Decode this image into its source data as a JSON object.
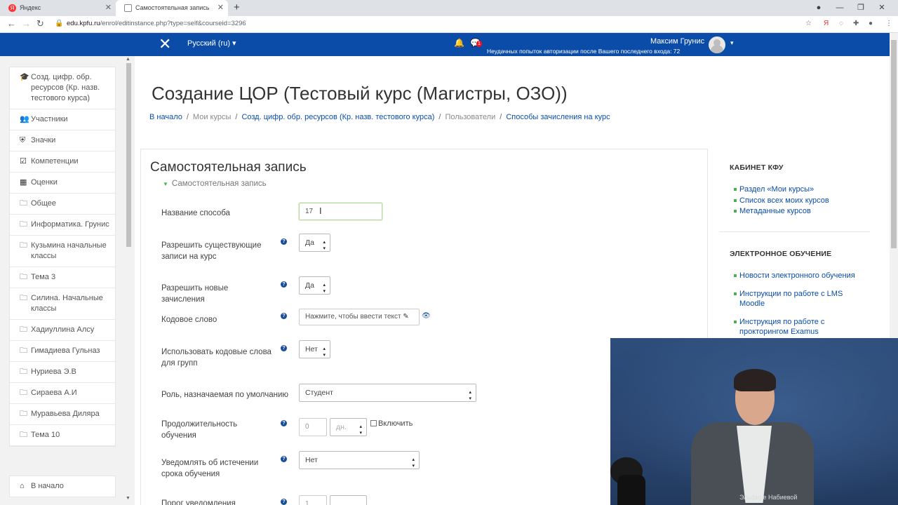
{
  "browser": {
    "tabs": [
      {
        "label": "Яндекс",
        "icon": "yandex-icon"
      },
      {
        "label": "Самостоятельная запись",
        "icon": "moodle-icon"
      }
    ],
    "url_host": "edu.kpfu.ru",
    "url_path": "/enrol/editinstance.php?type=self&courseid=3296"
  },
  "navbar": {
    "language": "Русский (ru)",
    "username": "Максим Грунис",
    "failed_logins": "Неудачных попыток авторизации после Вашего последнего входа: 72",
    "message_badge": "1"
  },
  "drawer": {
    "items": [
      {
        "label": "Созд. цифр. обр. ресурсов (Кр. назв. тестового курса)",
        "icon": "graduation-cap-icon"
      },
      {
        "label": "Участники",
        "icon": "users-icon"
      },
      {
        "label": "Значки",
        "icon": "shield-icon"
      },
      {
        "label": "Компетенции",
        "icon": "checkbox-icon"
      },
      {
        "label": "Оценки",
        "icon": "table-icon"
      },
      {
        "label": "Общее",
        "icon": "folder-icon"
      },
      {
        "label": "Информатика. Грунис",
        "icon": "folder-icon"
      },
      {
        "label": "Кузьмина начальные классы",
        "icon": "folder-icon"
      },
      {
        "label": "Тема 3",
        "icon": "folder-icon"
      },
      {
        "label": "Силина. Начальные классы",
        "icon": "folder-icon"
      },
      {
        "label": "Хадиуллина Алсу",
        "icon": "folder-icon"
      },
      {
        "label": "Гимадиева Гульназ",
        "icon": "folder-icon"
      },
      {
        "label": "Нуриева Э.В",
        "icon": "folder-icon"
      },
      {
        "label": "Сираева А.И",
        "icon": "folder-icon"
      },
      {
        "label": "Муравьева Диляра",
        "icon": "folder-icon"
      },
      {
        "label": "Тема 10",
        "icon": "folder-icon"
      }
    ],
    "home": "В начало"
  },
  "page": {
    "title": "Создание ЦОР (Тестовый курс (Магистры, ОЗО))",
    "breadcrumb": [
      "В начало",
      "Мои курсы",
      "Созд. цифр. обр. ресурсов (Кр. назв. тестового курса)",
      "Пользователи",
      "Способы зачисления на курс"
    ]
  },
  "form": {
    "title": "Самостоятельная запись",
    "legend": "Самостоятельная запись",
    "fields": {
      "name": {
        "label": "Название способа",
        "value": "17"
      },
      "allow_existing": {
        "label": "Разрешить существующие записи на курс",
        "value": "Да"
      },
      "allow_new": {
        "label": "Разрешить новые зачисления",
        "value": "Да"
      },
      "keyword": {
        "label": "Кодовое слово",
        "placeholder": "Нажмите, чтобы ввести текст"
      },
      "group_keys": {
        "label": "Использовать кодовые слова для групп",
        "value": "Нет"
      },
      "default_role": {
        "label": "Роль, назначаемая по умолчанию",
        "value": "Студент"
      },
      "duration": {
        "label": "Продолжительность обучения",
        "value": "0",
        "unit": "дн.",
        "enable": "Включить"
      },
      "notify_expiry": {
        "label": "Уведомлять об истечении срока обучения",
        "value": "Нет"
      },
      "notify_threshold": {
        "label": "Порог уведомления",
        "value": "1"
      }
    }
  },
  "blocks": [
    {
      "title": "КАБИНЕТ КФУ",
      "links": [
        "Раздел «Мои курсы»",
        "Список всех моих курсов",
        "Метаданные курсов"
      ]
    },
    {
      "title": "ЭЛЕКТРОННОЕ ОБУЧЕНИЕ",
      "links": [
        "Новости электронного обучения",
        "Инструкции по работе с LMS Moodle",
        "Инструкция по работе с прокторингом Examus"
      ]
    }
  ],
  "video": {
    "caption": "Эльфире Набиевой"
  },
  "colors": {
    "navbar": "#0b4ca8",
    "link": "#0b4ca8",
    "accent_green": "#4caf50"
  }
}
